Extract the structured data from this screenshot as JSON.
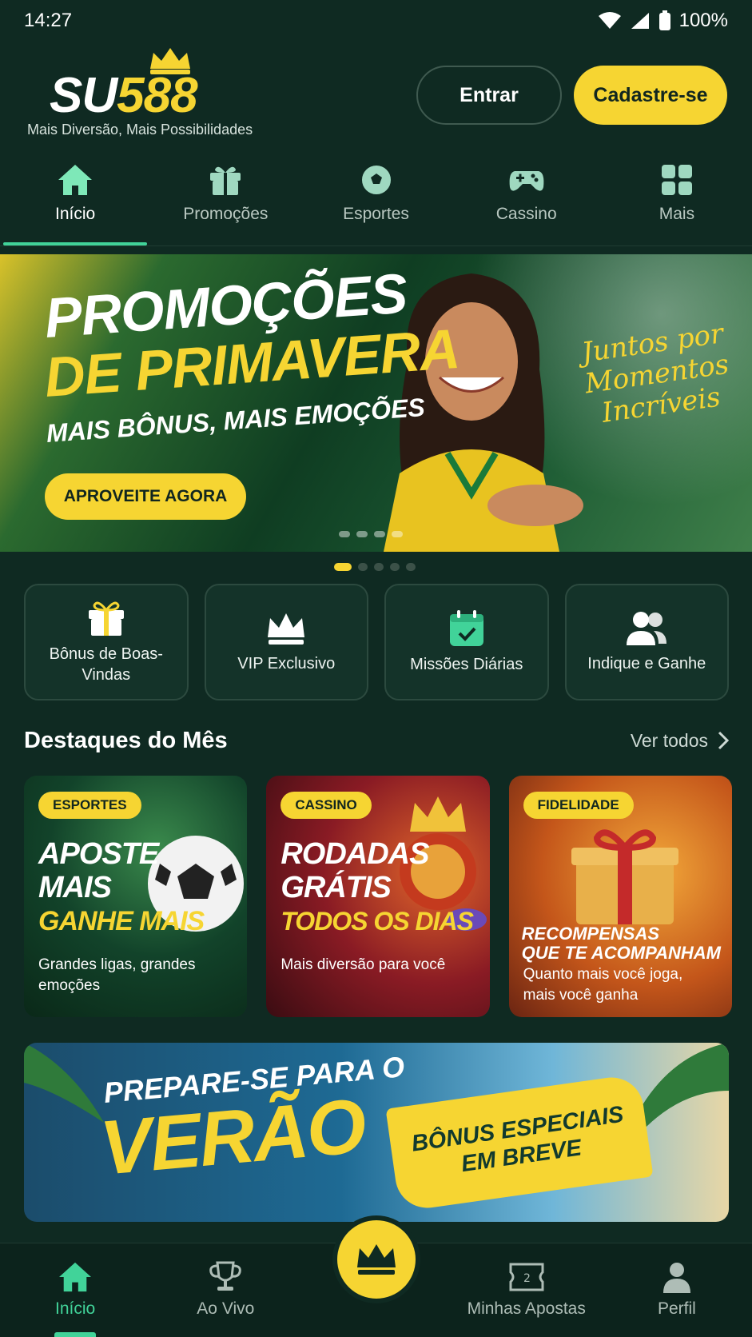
{
  "status_bar": {
    "time": "14:27",
    "battery": "100%"
  },
  "header": {
    "logo_su": "SU",
    "logo_num": "588",
    "tagline": "Mais Diversão, Mais Possibilidades",
    "login_label": "Entrar",
    "signup_label": "Cadastre-se"
  },
  "top_nav": [
    {
      "label": "Início",
      "icon": "home-icon",
      "active": true
    },
    {
      "label": "Promoções",
      "icon": "gift-icon"
    },
    {
      "label": "Esportes",
      "icon": "soccer-ball-icon"
    },
    {
      "label": "Cassino",
      "icon": "gamepad-icon"
    },
    {
      "label": "Mais",
      "icon": "grid-icon"
    }
  ],
  "hero": {
    "title_line1": "PROMOÇÕES",
    "title_line2": "DE PRIMAVERA",
    "subtitle": "MAIS BÔNUS, MAIS EMOÇÕES",
    "cta": "APROVEITE AGORA",
    "slogan": "Juntos por Momentos Incríveis",
    "slides": 5,
    "active_slide": 1
  },
  "quick_actions": [
    {
      "label": "Bônus de Boas-Vindas",
      "icon": "gift-icon"
    },
    {
      "label": "VIP Exclusivo",
      "icon": "crown-icon"
    },
    {
      "label": "Missões Diárias",
      "icon": "calendar-check-icon"
    },
    {
      "label": "Indique e Ganhe",
      "icon": "users-icon"
    }
  ],
  "highlights": {
    "title": "Destaques do Mês",
    "see_all": "Ver todos",
    "cards": [
      {
        "badge": "ESPORTES",
        "line1": "APOSTE",
        "line2": "MAIS",
        "line3": "GANHE MAIS",
        "desc": "Grandes ligas, grandes emoções"
      },
      {
        "badge": "CASSINO",
        "line1": "RODADAS",
        "line2": "GRÁTIS",
        "line3": "TODOS OS DIAS",
        "desc": "Mais diversão para você"
      },
      {
        "badge": "FIDELIDADE",
        "line1": "RECOMPENSAS",
        "line2": "QUE TE ACOMPANHAM",
        "desc": "Quanto mais você joga, mais você ganha"
      }
    ]
  },
  "summer_banner": {
    "line1": "PREPARE-SE PARA O",
    "line2": "VERÃO",
    "brush_line1": "BÔNUS ESPECIAIS",
    "brush_line2": "EM BREVE"
  },
  "bottom_nav": [
    {
      "label": "Início",
      "icon": "home-icon",
      "active": true
    },
    {
      "label": "Ao Vivo",
      "icon": "trophy-icon"
    },
    {
      "label": "",
      "icon": "crown-icon"
    },
    {
      "label": "Minhas Apostas",
      "icon": "ticket-icon"
    },
    {
      "label": "Perfil",
      "icon": "user-icon"
    }
  ],
  "colors": {
    "background": "#0f2a22",
    "accent_yellow": "#f6d532",
    "accent_green": "#41d399"
  }
}
